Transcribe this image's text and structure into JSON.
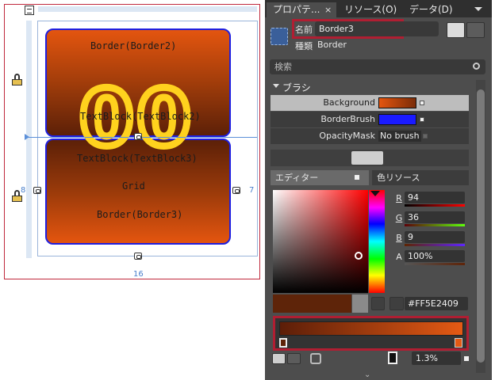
{
  "designer": {
    "labels": {
      "border_top": "Border(Border2)",
      "textblock2": "TextBlock(TextBlock2)",
      "textblock3": "TextBlock(TextBlock3)",
      "grid": "Grid",
      "border_bottom": "Border(Border3)"
    },
    "digits": "00",
    "margin_left": "8",
    "margin_right": "7",
    "margin_bottom": "16"
  },
  "panel": {
    "tabs": [
      {
        "label": "プロパテ..."
      },
      {
        "label": "リソース(O)"
      },
      {
        "label": "データ(D)"
      }
    ],
    "tab_close_glyph": "×",
    "name_label": "名前",
    "name_value": "Border3",
    "type_label": "種類",
    "type_value": "Border",
    "search_placeholder": "検索",
    "section_title": "ブラシ",
    "properties": [
      {
        "label": "Background",
        "swatch": "#9a3a0a"
      },
      {
        "label": "BorderBrush",
        "swatch": "#1a1aff"
      },
      {
        "label": "OpacityMask",
        "value": "No brush"
      }
    ],
    "editor_tabs": [
      {
        "label": "エディター"
      },
      {
        "label": "色リソース"
      }
    ],
    "channels": [
      {
        "label": "R",
        "value": "94"
      },
      {
        "label": "G",
        "value": "36"
      },
      {
        "label": "B",
        "value": "9"
      },
      {
        "label": "A",
        "value": "100%"
      }
    ],
    "hex_value": "#FF5E2409",
    "offset_value": "1.3%"
  },
  "colors": {
    "accent_red": "#b01e32",
    "border_blue": "#1f1fe0",
    "digit_yellow": "#ffd21e",
    "current_color": "#5e2409"
  }
}
